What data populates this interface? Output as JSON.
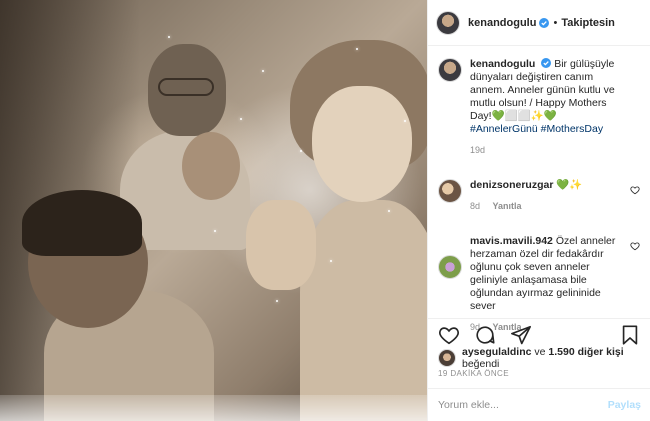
{
  "post": {
    "username": "kenandogulu",
    "follow_state": "Takiptesin",
    "separator": "•"
  },
  "caption": {
    "username": "kenandogulu",
    "text": "Bir gülüşüyle dünyaları değiştiren canım annem. Anneler günün kutlu ve mutlu olsun! / Happy Mothers Day!",
    "emojis": "💚⬜⬜✨💚",
    "hashtags": "#AnnelerGünü #MothersDay",
    "age": "19d"
  },
  "comments": [
    {
      "username": "denizsoneruzgar",
      "text": "💚✨",
      "age": "8d",
      "reply_label": "Yanıtla"
    },
    {
      "username": "mavis.mavili.942",
      "text": "Özel anneler herzaman özel dir fedakârdır oğlunu çok seven anneler geliniyle anlaşamasa bile oğlundan ayırmaz gelininide sever",
      "age": "9d",
      "reply_label": "Yanıtla"
    }
  ],
  "icons": {
    "verified": "verified-badge-icon",
    "like": "heart-icon",
    "comment": "comment-icon",
    "share": "paper-plane-icon",
    "save": "bookmark-icon"
  },
  "likes": {
    "username": "aysegulaldinc",
    "connector": "ve",
    "others": "1.590 diğer kişi",
    "suffix": "beğendi"
  },
  "timestamp": "19 DAKİKA ÖNCE",
  "add_comment": {
    "placeholder": "Yorum ekle...",
    "post_label": "Paylaş"
  },
  "colors": {
    "verified": "#3897f0",
    "hashtag": "#003569",
    "muted": "#8e8e8e",
    "post_disabled": "#b2dffc"
  }
}
